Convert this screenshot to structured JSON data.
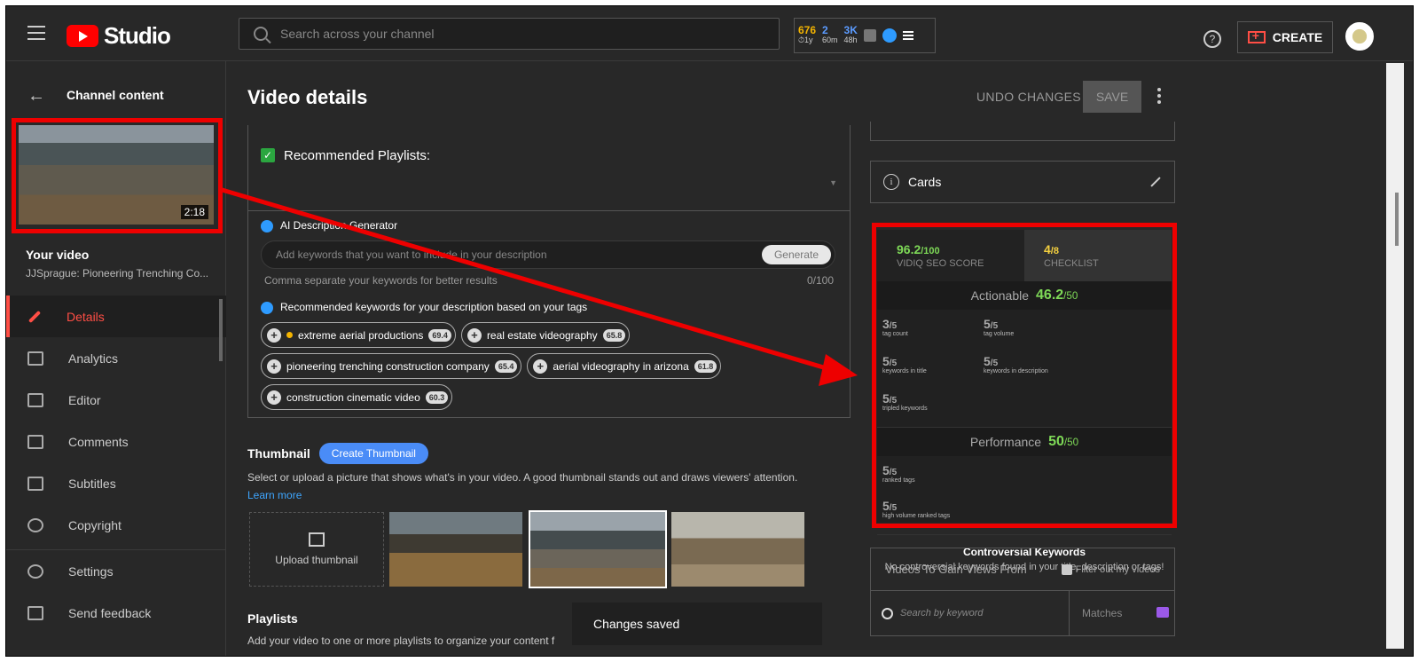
{
  "header": {
    "logo_text": "Studio",
    "search_placeholder": "Search across your channel",
    "stats": [
      {
        "value": "676",
        "sub": "⏱1y",
        "color": "#f4b400"
      },
      {
        "value": "2",
        "sub": "60m",
        "color": "#5b9bff"
      },
      {
        "value": "3K",
        "sub": "48h",
        "color": "#5b9bff"
      }
    ],
    "help": "?",
    "create_label": "CREATE"
  },
  "sidebar": {
    "channel_title": "Channel content",
    "video_duration": "2:18",
    "your_video": "Your video",
    "video_name": "JJSprague: Pioneering Trenching Co...",
    "items": [
      {
        "label": "Details",
        "icon": "pencil-icon"
      },
      {
        "label": "Analytics",
        "icon": "analytics-icon"
      },
      {
        "label": "Editor",
        "icon": "editor-icon"
      },
      {
        "label": "Comments",
        "icon": "comments-icon"
      },
      {
        "label": "Subtitles",
        "icon": "subtitles-icon"
      },
      {
        "label": "Copyright",
        "icon": "copyright-icon"
      }
    ],
    "bottom_items": [
      {
        "label": "Settings",
        "icon": "gear-icon"
      },
      {
        "label": "Send feedback",
        "icon": "feedback-icon"
      }
    ]
  },
  "main": {
    "title": "Video details",
    "undo_label": "UNDO CHANGES",
    "save_label": "SAVE",
    "recommended_playlists": "Recommended Playlists:",
    "ai_title": "AI Description Generator",
    "ai_placeholder": "Add keywords that you want to include in your description",
    "generate_label": "Generate",
    "hint": "Comma separate your keywords for better results",
    "counter": "0/100",
    "rec_keywords_title": "Recommended keywords for your description based on your tags",
    "chips": [
      {
        "label": "extreme aerial productions",
        "score": "69.4"
      },
      {
        "label": "real estate videography",
        "score": "65.8"
      },
      {
        "label": "pioneering trenching construction company",
        "score": "65.4"
      },
      {
        "label": "aerial videography in arizona",
        "score": "61.8"
      },
      {
        "label": "construction cinematic video",
        "score": "60.3"
      }
    ],
    "thumbnail_title": "Thumbnail",
    "create_thumbnail": "Create Thumbnail",
    "thumbnail_desc": "Select or upload a picture that shows what's in your video. A good thumbnail stands out and draws viewers' attention.",
    "learn_more": "Learn more",
    "upload_thumbnail": "Upload thumbnail",
    "playlists_title": "Playlists",
    "playlists_desc": "Add your video to one or more playlists to organize your content f",
    "toast": "Changes saved"
  },
  "right": {
    "cards_label": "Cards",
    "seo": {
      "score": "96.2",
      "score_max": "/100",
      "score_label": "VIDIQ SEO SCORE",
      "checklist": "4",
      "checklist_max": "/8",
      "checklist_label": "CHECKLIST",
      "actionable_label": "Actionable",
      "actionable_value": "46.2",
      "actionable_max": "/50",
      "actionable_items": [
        {
          "n": "3",
          "max": "/5",
          "label": "tag count"
        },
        {
          "n": "5",
          "max": "/5",
          "label": "tag volume"
        },
        {
          "n": "5",
          "max": "/5",
          "label": "keywords in title"
        },
        {
          "n": "5",
          "max": "/5",
          "label": "keywords in description"
        },
        {
          "n": "5",
          "max": "/5",
          "label": "tripled keywords"
        }
      ],
      "performance_label": "Performance",
      "performance_value": "50",
      "performance_max": "/50",
      "performance_items": [
        {
          "n": "5",
          "max": "/5",
          "label": "ranked tags"
        },
        {
          "n": "5",
          "max": "/5",
          "label": "high volume ranked tags"
        }
      ],
      "controversial_title": "Controversial Keywords",
      "controversial_desc": "No controversial keywords found in your title, description or tags!"
    },
    "videos_gain_title": "Videos To Gain Views From",
    "filter_label": "Filter out my videos",
    "search_keyword": "Search by keyword",
    "matches_label": "Matches"
  }
}
